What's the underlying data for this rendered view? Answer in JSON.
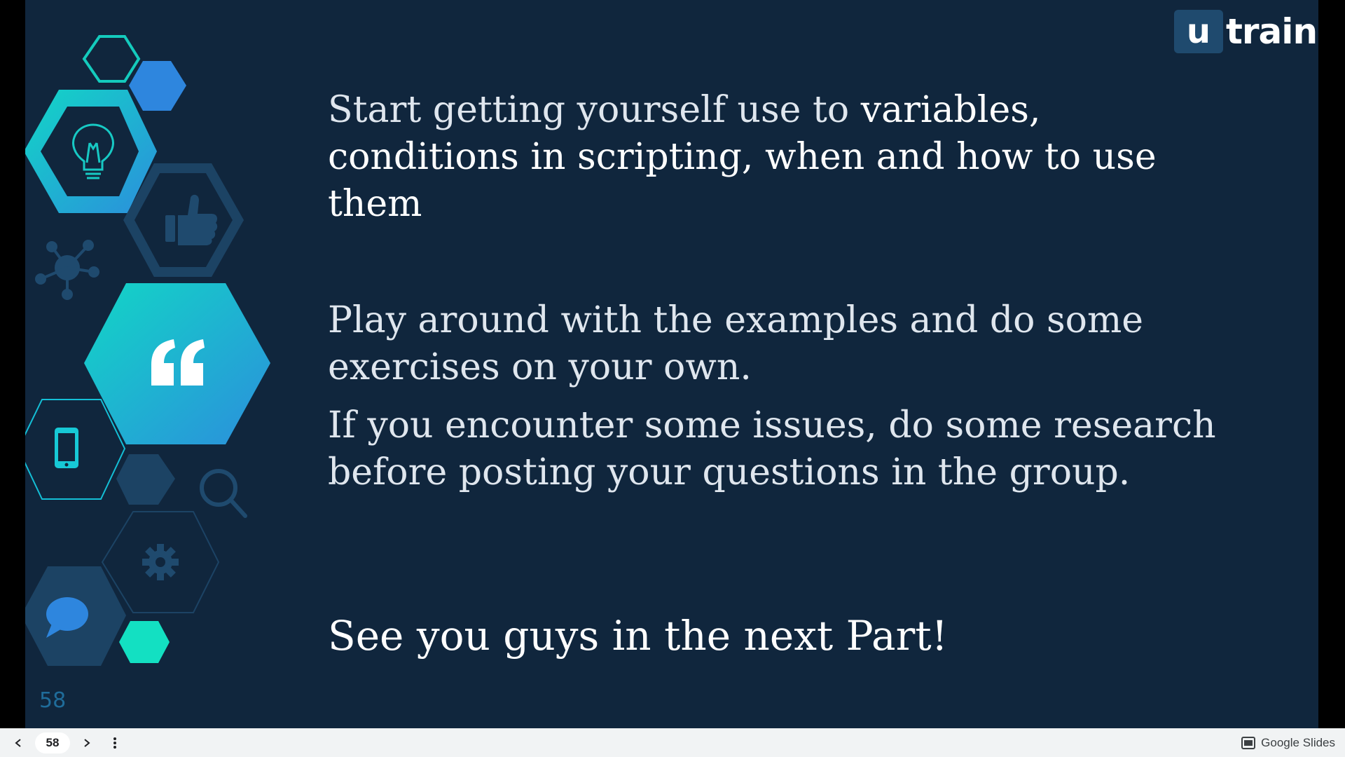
{
  "logo": {
    "letter": "u",
    "word": "train"
  },
  "slide": {
    "paragraph1": {
      "light": "Start getting yourself use to ",
      "strong": "variables, conditions in scripting, when and how to use them"
    },
    "paragraph2": "Play around with the examples and do some exercises on your own.",
    "paragraph3": "If you encounter some issues, do some research before posting your questions in the group.",
    "paragraph4": "See you guys in the next Part!",
    "slide_number": "58"
  },
  "icons": [
    "lightbulb-icon",
    "thumbs-up-icon",
    "network-icon",
    "quote-icon",
    "smartphone-icon",
    "search-icon",
    "gear-icon",
    "chat-bubble-icon"
  ],
  "toolbar": {
    "page": "58",
    "brand": "Google Slides"
  },
  "colors": {
    "background": "#10263d",
    "accent_teal": "#12d1c8",
    "accent_blue": "#2e86de",
    "dark_hex": "#1c4364"
  }
}
